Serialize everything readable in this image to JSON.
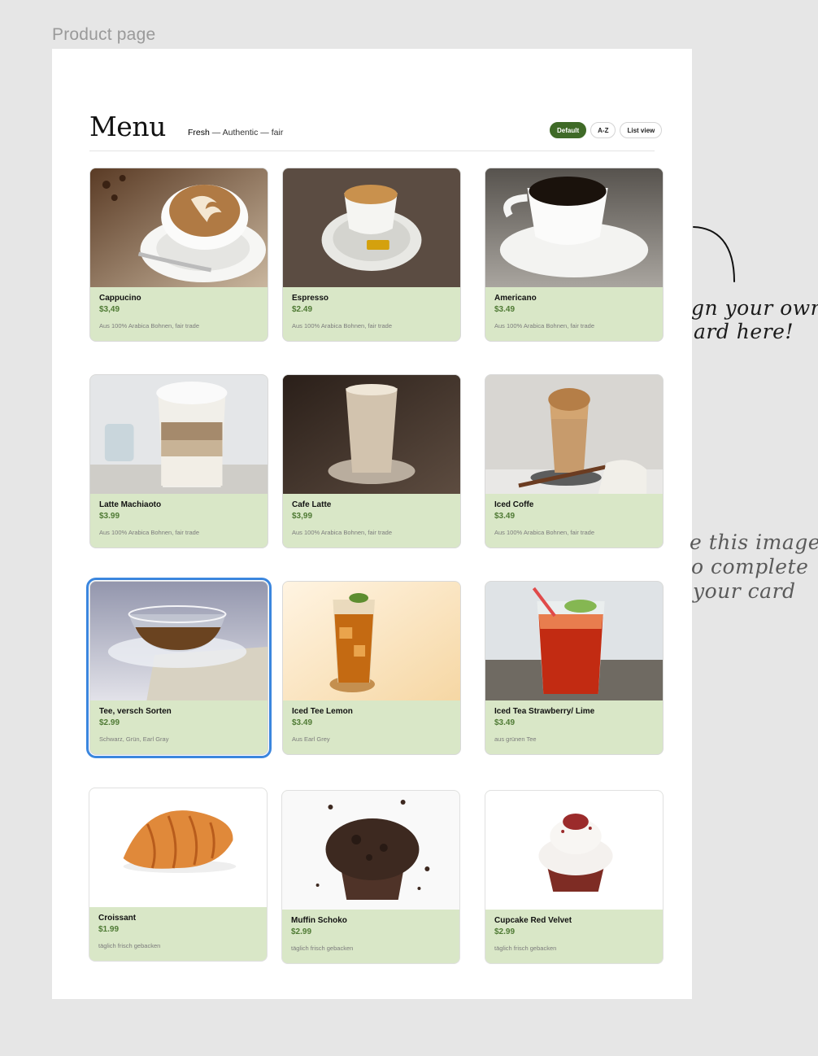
{
  "frame_label": "Product page",
  "header": {
    "title": "Menu",
    "tagline_lead": "Fresh",
    "tagline_dash": " — ",
    "tagline_rest": " Authentic — fair"
  },
  "sort": [
    {
      "label": "Default",
      "active": true
    },
    {
      "label": "A-Z",
      "active": false
    },
    {
      "label": "List view",
      "active": false
    }
  ],
  "products": [
    {
      "name": "Cappucino",
      "price": "$3,49",
      "desc": "Aus 100% Arabica Bohnen, fair trade",
      "image": "cappuccino-photo"
    },
    {
      "name": "Espresso",
      "price": "$2.49",
      "desc": "Aus 100% Arabica Bohnen, fair trade",
      "image": "espresso-photo"
    },
    {
      "name": "Americano",
      "price": "$3.49",
      "desc": "Aus 100% Arabica Bohnen, fair trade",
      "image": "americano-photo"
    },
    {
      "name": "Latte Machiaoto",
      "price": "$3.99",
      "desc": "Aus 100% Arabica Bohnen, fair trade",
      "image": "latte-macchiato-photo"
    },
    {
      "name": "Cafe Latte",
      "price": "$3,99",
      "desc": "Aus 100% Arabica Bohnen, fair trade",
      "image": "cafe-latte-photo"
    },
    {
      "name": "Iced Coffe",
      "price": "$3.49",
      "desc": "Aus 100% Arabica Bohnen, fair trade",
      "image": "iced-coffee-photo"
    },
    {
      "name": "Tee, versch Sorten",
      "price": "$2.99",
      "desc": "Schwarz, Grün, Earl  Gray",
      "image": "tea-cup-photo",
      "selected": true
    },
    {
      "name": "Iced Tee Lemon",
      "price": "$3.49",
      "desc": "Aus Earl Grey",
      "image": "iced-tea-lemon-photo"
    },
    {
      "name": "Iced Tea Strawberry/ Lime",
      "price": "$3.49",
      "desc": "aus grünen Tee",
      "image": "iced-tea-strawberry-photo"
    },
    {
      "name": "Croissant",
      "price": "$1.99",
      "desc": "täglich frisch gebacken",
      "image": "croissant-photo"
    },
    {
      "name": "Muffin Schoko",
      "price": "$2.99",
      "desc": "täglich frisch gebacken",
      "image": "muffin-photo"
    },
    {
      "name": "Cupcake Red Velvet",
      "price": "$2.99",
      "desc": "täglich frisch gebacken",
      "image": "cupcake-photo"
    }
  ],
  "annotations": {
    "design_note_line1": "gn your own",
    "design_note_line2": "ard here!",
    "image_note_line1": "e this image",
    "image_note_line2": "o complete",
    "image_note_line3": "your card"
  }
}
